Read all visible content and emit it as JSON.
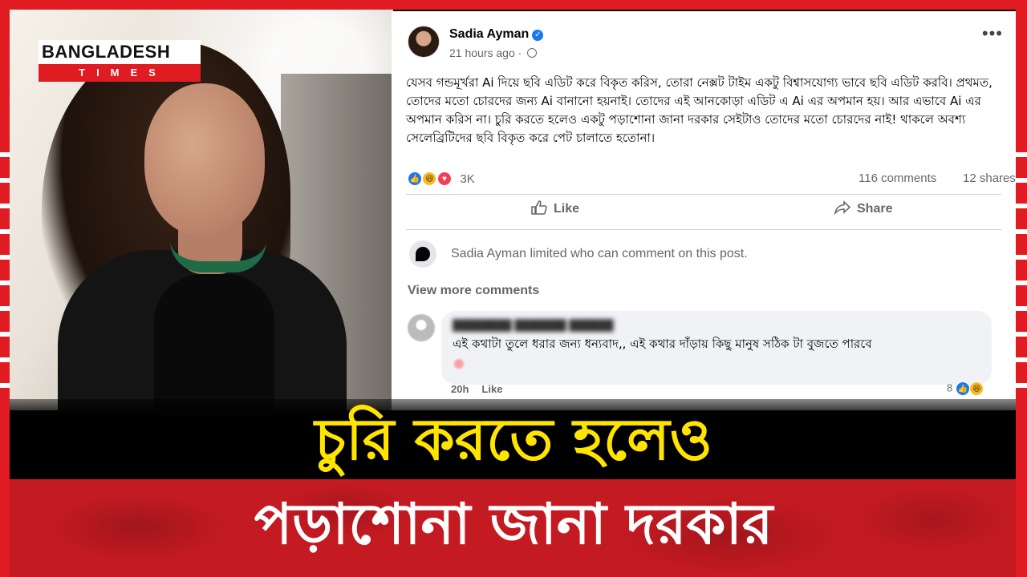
{
  "channel": {
    "logo_line1": "BANGLADESH",
    "logo_line2": "TIMES",
    "brand_color": "#e01b22"
  },
  "post": {
    "author": "Sadia Ayman",
    "time": "21 hours ago",
    "verified_icon": "verified-badge-icon",
    "privacy_icon": "globe-icon",
    "body": "যেসব গন্ডমূর্খরা Ai দিয়ে ছবি এডিট করে বিকৃত করিস, তোরা নেক্সট টাইম একটু বিশ্বাসযোগ্য ভাবে ছবি এডিট করবি। প্রথমত, তোদের মতো চোরদের জন্য Ai বানানো হয়নাই। তোদের এই আনকোড়া এডিট এ Ai এর অপমান হয়। আর এভাবে Ai এর অপমান করিস না। চুরি করতে হলেও একটু পড়াশোনা জানা দরকার সেইটাও তোদের মতো চোরদের নাই! থাকলে অবশ্য সেলেব্রিটিদের ছবি বিকৃত করে পেট চালাতে হতোনা।",
    "reactions": {
      "icons": [
        "like-reaction-icon",
        "haha-reaction-icon",
        "love-reaction-icon"
      ],
      "count": "3K"
    },
    "comments_count": "116 comments",
    "shares_count": "12 shares",
    "actions": {
      "like": "Like",
      "share": "Share"
    },
    "limited_notice": "Sadia Ayman limited who can comment on this post.",
    "view_more": "View more comments",
    "comment": {
      "text": "এই কথাটা তুলে ধরার জন্য ধন্যবাদ,, এই কথার দাঁড়ায় কিছু মানুষ সঠিক টা বুজতে পারবে",
      "age": "20h",
      "like_label": "Like",
      "reaction_count": "8"
    }
  },
  "headline": {
    "line1": "চুরি করতে হলেও",
    "line2": "পড়াশোনা জানা দরকার",
    "line1_color": "#ffe400",
    "line2_color": "#ffffff",
    "band2_color": "#c41a22"
  }
}
